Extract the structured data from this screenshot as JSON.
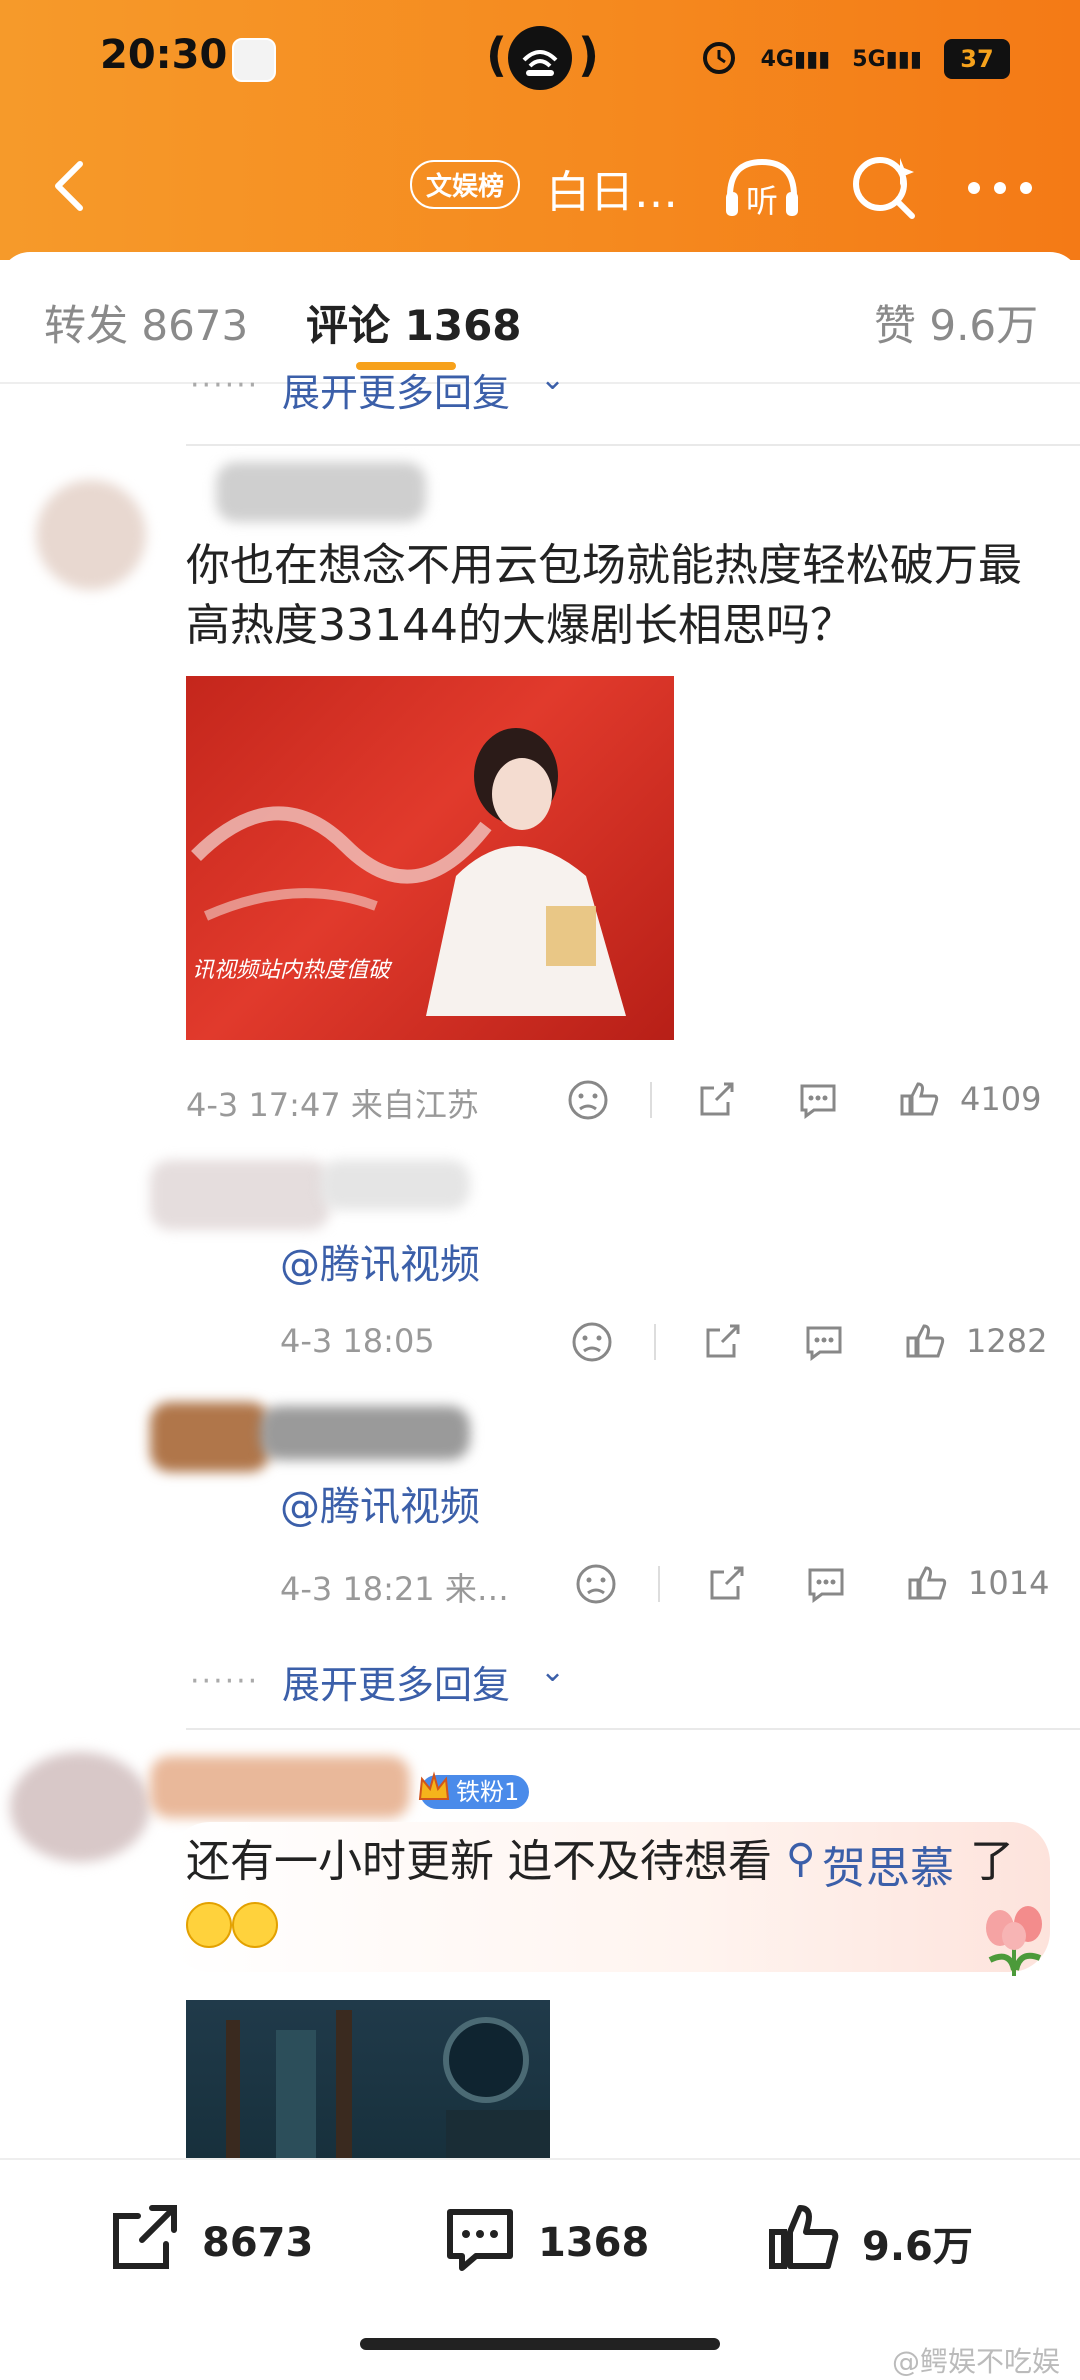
{
  "status": {
    "time": "20:30",
    "net1": "4G",
    "net2": "5G",
    "battery": "37"
  },
  "nav": {
    "badge": "文娱榜",
    "title": "白日…",
    "listen": "听"
  },
  "tabs": [
    {
      "label": "转发 8673"
    },
    {
      "label": "评论 1368"
    },
    {
      "label": "赞 9.6万"
    }
  ],
  "expand_label": "展开更多回复",
  "comment1": {
    "text": "你也在想念不用云包场就能热度轻松破万最高热度33144的大爆剧长相思吗？",
    "image_caption": "讯视频站内热度值破",
    "meta": "4-3 17:47  来自江苏",
    "likes": "4109",
    "replies": [
      {
        "text": "@腾讯视频",
        "meta": "4-3 18:05",
        "likes": "1282"
      },
      {
        "text": "@腾讯视频",
        "meta": "4-3 18:21  来…",
        "likes": "1014"
      }
    ]
  },
  "comment2": {
    "fan_badge": "铁粉1",
    "text_before": "还有一小时更新 迫不及待想看",
    "topic": "贺思慕",
    "text_after": "了"
  },
  "bottom": {
    "repost": "8673",
    "comments": "1368",
    "likes": "9.6万"
  },
  "watermark": "@鳄娱不吃娱",
  "colors": {
    "accent": "#f58a1f",
    "link": "#3b5fa9",
    "underline": "#f7a11b"
  }
}
